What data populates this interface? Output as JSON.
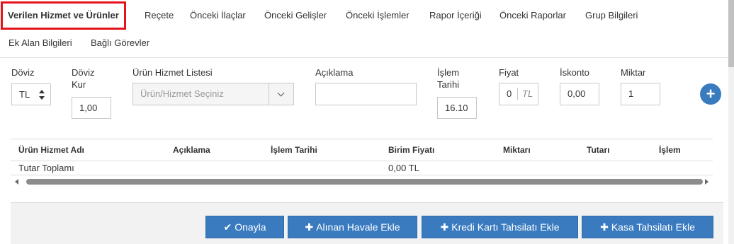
{
  "tabs": [
    {
      "label": "Verilen Hizmet ve Ürünler",
      "active": true
    },
    {
      "label": "Reçete"
    },
    {
      "label": "Önceki İlaçlar"
    },
    {
      "label": "Önceki Gelişler"
    },
    {
      "label": "Önceki İşlemler"
    },
    {
      "label": "Rapor İçeriği"
    },
    {
      "label": "Önceki Raporlar"
    },
    {
      "label": "Grup Bilgileri"
    },
    {
      "label": "Ek Alan Bilgileri"
    },
    {
      "label": "Bağlı Görevler"
    }
  ],
  "form": {
    "currency_label": "Döviz",
    "currency_value": "TL",
    "rate_label_1": "Döviz",
    "rate_label_2": "Kur",
    "rate_value": "1,00",
    "product_label": "Ürün Hizmet Listesi",
    "product_placeholder": "Ürün/Hizmet Seçiniz",
    "description_label": "Açıklama",
    "description_value": "",
    "date_label_1": "İşlem",
    "date_label_2": "Tarihi",
    "date_value": "16.10",
    "price_label": "Fiyat",
    "price_value": "0",
    "price_unit": "TL",
    "discount_label": "İskonto",
    "discount_value": "0,00",
    "quantity_label": "Miktar",
    "quantity_value": "1",
    "add_icon": "plus-icon"
  },
  "grid": {
    "columns": [
      "Ürün Hizmet Adı",
      "Açıklama",
      "İşlem Tarihi",
      "Birim Fiyatı",
      "Miktarı",
      "Tutarı",
      "İşlem"
    ],
    "total_label": "Tutar Toplamı",
    "total_value": "0,00 TL"
  },
  "actions": {
    "approve": {
      "icon": "✔",
      "label": "Onayla"
    },
    "transfer": {
      "icon": "✚",
      "label": "Alınan Havale Ekle"
    },
    "card": {
      "icon": "✚",
      "label": "Kredi Kartı Tahsilatı Ekle"
    },
    "cash": {
      "icon": "✚",
      "label": "Kasa Tahsilatı Ekle"
    }
  },
  "colors": {
    "accent": "#3a7bc0",
    "active_tab_border": "#e3141c"
  }
}
